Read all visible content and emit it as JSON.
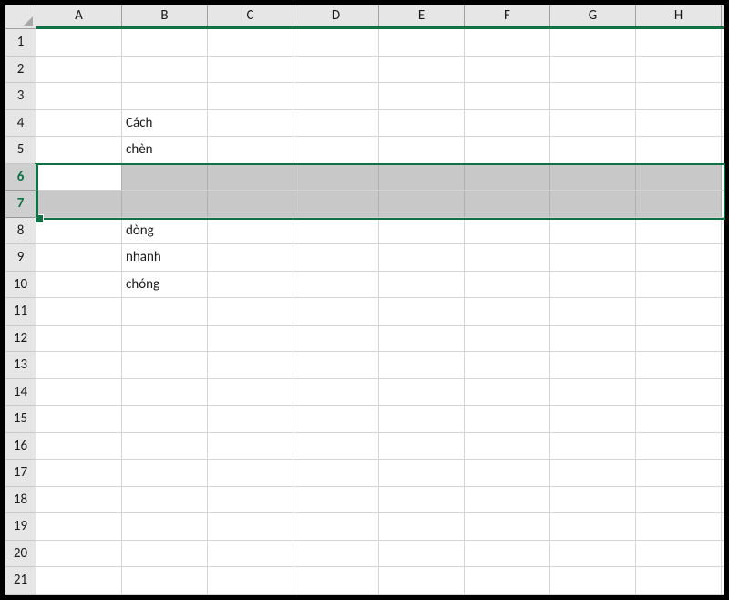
{
  "columns": [
    "A",
    "B",
    "C",
    "D",
    "E",
    "F",
    "G",
    "H"
  ],
  "rows": [
    "1",
    "2",
    "3",
    "4",
    "5",
    "6",
    "7",
    "8",
    "9",
    "10",
    "11",
    "12",
    "13",
    "14",
    "15",
    "16",
    "17",
    "18",
    "19",
    "20",
    "21"
  ],
  "selectedRows": [
    6,
    7
  ],
  "activeCell": {
    "row": 6,
    "col": "A"
  },
  "cells": {
    "B4": "Cách",
    "B5": "chèn",
    "B8": "dòng",
    "B9": "nhanh",
    "B10": "chóng"
  }
}
